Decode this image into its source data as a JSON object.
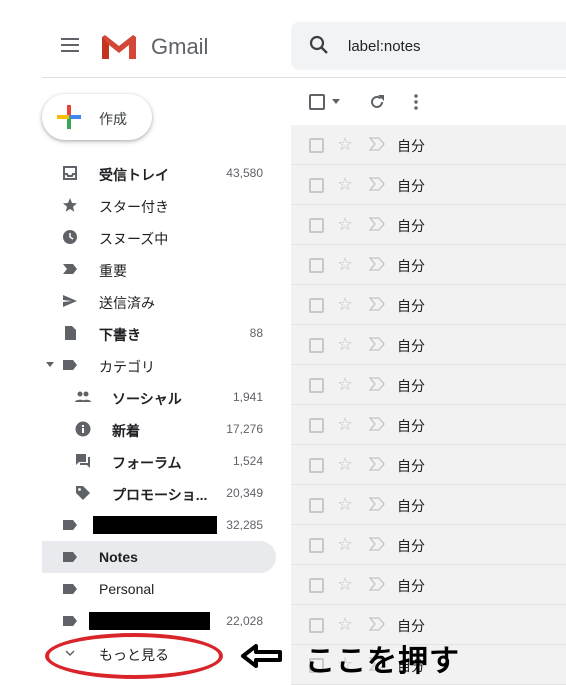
{
  "header": {
    "brand": "Gmail",
    "search_value": "label:notes"
  },
  "compose_label": "作成",
  "sidebar": {
    "items": [
      {
        "label": "受信トレイ",
        "count": "43,580",
        "icon": "inbox-icon",
        "bold": true
      },
      {
        "label": "スター付き",
        "count": "",
        "icon": "star-icon"
      },
      {
        "label": "スヌーズ中",
        "count": "",
        "icon": "clock-icon"
      },
      {
        "label": "重要",
        "count": "",
        "icon": "important-icon"
      },
      {
        "label": "送信済み",
        "count": "",
        "icon": "send-icon"
      },
      {
        "label": "下書き",
        "count": "88",
        "icon": "draft-icon",
        "bold": true
      },
      {
        "label": "カテゴリ",
        "count": "",
        "icon": "label-icon"
      },
      {
        "label": "ソーシャル",
        "count": "1,941",
        "icon": "people-icon",
        "bold": true
      },
      {
        "label": "新着",
        "count": "17,276",
        "icon": "info-icon",
        "bold": true
      },
      {
        "label": "フォーラム",
        "count": "1,524",
        "icon": "forum-icon",
        "bold": true
      },
      {
        "label": "プロモーショ...",
        "count": "20,349",
        "icon": "tag-icon",
        "bold": true
      },
      {
        "label": "",
        "count": "32,285",
        "icon": "label-icon",
        "redacted": true
      },
      {
        "label": "Notes",
        "count": "",
        "icon": "label-icon",
        "bold": true,
        "selected": true
      },
      {
        "label": "Personal",
        "count": "",
        "icon": "label-icon"
      },
      {
        "label": "",
        "count": "22,028",
        "icon": "label-icon",
        "redacted": true
      },
      {
        "label": "もっと見る",
        "count": "",
        "icon": "chevron-down-icon"
      }
    ]
  },
  "messages": {
    "sender": "自分",
    "row_count": 14
  },
  "annotation": {
    "text": "ここを押す",
    "color": "#d9252a"
  }
}
